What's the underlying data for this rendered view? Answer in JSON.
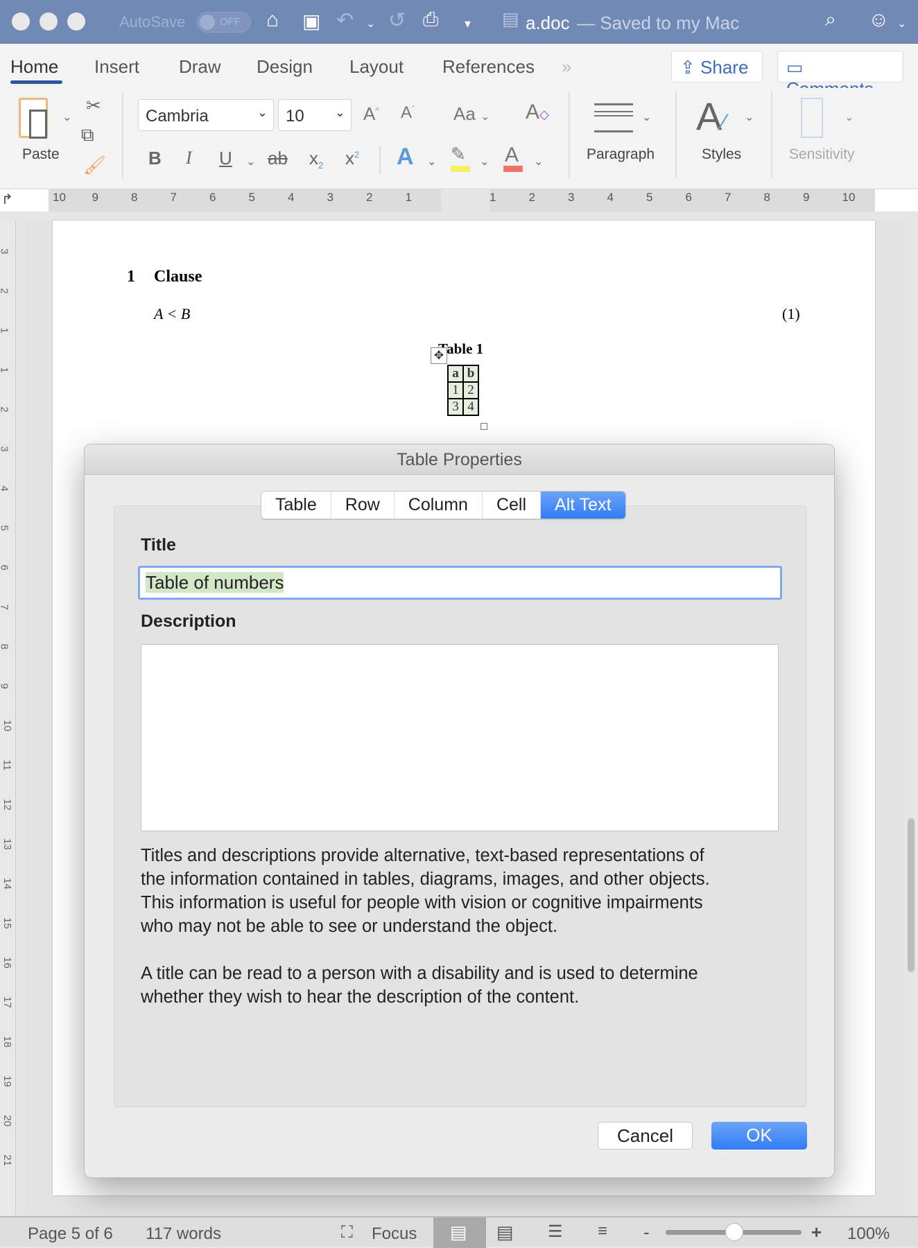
{
  "titlebar": {
    "autosave_label": "AutoSave",
    "autosave_state": "OFF",
    "document_title": "a.doc",
    "saved_status": "— Saved to my Mac"
  },
  "ribbon_tabs": [
    {
      "label": "Home",
      "active": true
    },
    {
      "label": "Insert"
    },
    {
      "label": "Draw"
    },
    {
      "label": "Design"
    },
    {
      "label": "Layout"
    },
    {
      "label": "References"
    }
  ],
  "share_label": "Share",
  "comments_label": "Comments",
  "ribbon": {
    "paste_label": "Paste",
    "font_name": "Cambria",
    "font_size": "10",
    "change_case": "Aa",
    "paragraph_label": "Paragraph",
    "styles_label": "Styles",
    "sensitivity_label": "Sensitivity",
    "bold": "B",
    "italic": "I",
    "underline": "U",
    "strikethrough": "ab",
    "subscript": "x",
    "superscript": "x",
    "highlight_color": "#f7f066",
    "font_color": "#f07468"
  },
  "ruler": {
    "left": [
      "10",
      "9",
      "8",
      "7",
      "6",
      "5",
      "4",
      "3",
      "2",
      "1"
    ],
    "right": [
      "1",
      "2",
      "3",
      "4",
      "5",
      "6",
      "7",
      "8",
      "9",
      "10"
    ],
    "vertical": [
      "3",
      "2",
      "1",
      "1",
      "2",
      "3",
      "4",
      "5",
      "6",
      "7",
      "8",
      "9",
      "10",
      "11",
      "12",
      "13",
      "14",
      "15",
      "16",
      "17",
      "18",
      "19",
      "20",
      "21"
    ]
  },
  "document": {
    "heading_number": "1",
    "heading_text": "Clause",
    "equation": "A < B",
    "equation_number": "(1)",
    "table_caption": "Table 1",
    "table": [
      [
        "a",
        "b"
      ],
      [
        "1",
        "2"
      ],
      [
        "3",
        "4"
      ]
    ]
  },
  "dialog": {
    "title": "Table Properties",
    "tabs": [
      "Table",
      "Row",
      "Column",
      "Cell",
      "Alt Text"
    ],
    "active_tab": "Alt Text",
    "title_label": "Title",
    "title_value": "Table of numbers",
    "description_label": "Description",
    "description_value": "",
    "info_para1": [
      "Titles and descriptions provide alternative, text-based representations of",
      "the information contained in tables, diagrams, images, and other objects.",
      "This information is useful for people with vision or cognitive impairments",
      "who may not be able to see or understand the object."
    ],
    "info_para2": [
      "A title can be read to a person with a disability and is used to determine",
      "whether they wish to hear the description of the content."
    ],
    "cancel_label": "Cancel",
    "ok_label": "OK",
    "accent": "#2f7cf5"
  },
  "statusbar": {
    "page": "Page 5 of 6",
    "words": "117 words",
    "focus_label": "Focus",
    "zoom": "100%",
    "zoom_minus": "-",
    "zoom_plus": "+"
  }
}
